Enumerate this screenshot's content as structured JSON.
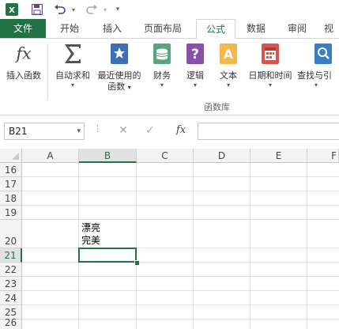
{
  "tabs": {
    "file": "文件",
    "home": "开始",
    "insert": "插入",
    "page_layout": "页面布局",
    "formulas": "公式",
    "data": "数据",
    "review": "审阅",
    "view": "视"
  },
  "ribbon": {
    "insert_function": "插入函数",
    "autosum": "自动求和",
    "recently_used_line1": "最近使用的",
    "recently_used_line2": "函数",
    "financial": "财务",
    "logical": "逻辑",
    "text": "文本",
    "date_time": "日期和时间",
    "lookup": "查找与引",
    "group_label": "函数库"
  },
  "formula_bar": {
    "name_box": "B21",
    "fx": "fx",
    "value": ""
  },
  "grid": {
    "columns": [
      "A",
      "B",
      "C",
      "D",
      "E",
      "F"
    ],
    "rows": [
      "16",
      "17",
      "18",
      "19",
      "20",
      "21",
      "22",
      "23",
      "24",
      "25",
      "26"
    ],
    "selected_column": "B",
    "selected_row": "21",
    "cell_b20_line1": "漂亮",
    "cell_b20_line2": "完美"
  },
  "colors": {
    "accent": "#217346",
    "file_tab": "#217346"
  }
}
